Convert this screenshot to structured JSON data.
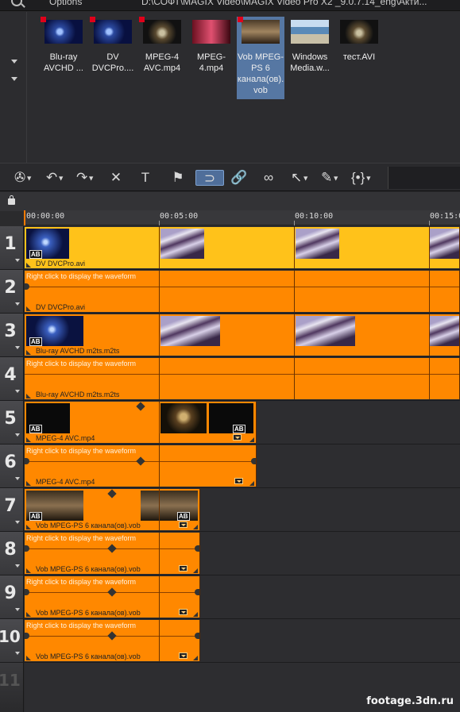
{
  "topbar": {
    "options_label": "Options",
    "path": "D:\\СОФТ\\MAGIX Video\\MAGIX Video Pro X2 _9.0.7.14_eng\\Акти..."
  },
  "media_pool": {
    "files": [
      {
        "label": "Blu-ray AVCHD ...",
        "thumb": "blue",
        "marked": true,
        "selected": false
      },
      {
        "label": "DV DVCPro....",
        "thumb": "blue",
        "marked": true,
        "selected": false
      },
      {
        "label": "MPEG-4 AVC.mp4",
        "thumb": "fan",
        "marked": true,
        "selected": false
      },
      {
        "label": "MPEG-4.mp4",
        "thumb": "pink",
        "marked": false,
        "selected": false
      },
      {
        "label": "Vob MPEG-PS 6 канала(ов).vob",
        "thumb": "movie",
        "marked": true,
        "selected": true
      },
      {
        "label": "Windows Media.w...",
        "thumb": "sea",
        "marked": false,
        "selected": false
      },
      {
        "label": "тест.AVI",
        "thumb": "fan",
        "marked": false,
        "selected": false
      }
    ]
  },
  "toolbar": {
    "buttons": [
      {
        "name": "reel-menu-button",
        "icon": "reel-icon",
        "glyph": "✇",
        "dropdown": true,
        "active": false
      },
      {
        "name": "undo-button",
        "icon": "undo-icon",
        "glyph": "↶",
        "dropdown": true,
        "active": false
      },
      {
        "name": "redo-button",
        "icon": "redo-icon",
        "glyph": "↷",
        "dropdown": true,
        "active": false
      },
      {
        "name": "delete-button",
        "icon": "close-icon",
        "glyph": "✕",
        "dropdown": false,
        "active": false
      },
      {
        "name": "title-button",
        "icon": "text-icon",
        "glyph": "T",
        "dropdown": false,
        "active": false
      },
      {
        "name": "marker-button",
        "icon": "flag-icon",
        "glyph": "⚑",
        "dropdown": false,
        "active": false
      },
      {
        "name": "magnet-button",
        "icon": "magnet-icon",
        "glyph": "⊃",
        "dropdown": false,
        "active": true
      },
      {
        "name": "link-button",
        "icon": "link-icon",
        "glyph": "🔗",
        "dropdown": false,
        "active": false
      },
      {
        "name": "unlink-button",
        "icon": "unlink-icon",
        "glyph": "∞",
        "dropdown": false,
        "active": false
      },
      {
        "name": "mouse-mode-button",
        "icon": "cursor-icon",
        "glyph": "↖",
        "dropdown": true,
        "active": false
      },
      {
        "name": "razor-button",
        "icon": "razor-icon",
        "glyph": "✎",
        "dropdown": true,
        "active": false
      },
      {
        "name": "group-button",
        "icon": "bracket-icon",
        "glyph": "{•}",
        "dropdown": true,
        "active": false
      }
    ]
  },
  "ruler": {
    "ticks": [
      "00:00:00",
      "00:05:00",
      "00:10:00",
      "00:15:00"
    ]
  },
  "tracks": {
    "numbers": [
      "1",
      "2",
      "3",
      "4",
      "5",
      "6",
      "7",
      "8",
      "9",
      "10",
      "11"
    ],
    "waveform_hint": "Right click to display the waveform",
    "ab_badge": "AB",
    "clip_names": {
      "dv": "DV DVCPro.avi",
      "bluray": "Blu-ray AVCHD m2ts.m2ts",
      "mpeg4": "MPEG-4 AVC.mp4",
      "vob": "Vob MPEG-PS 6 канала(ов).vob"
    }
  },
  "watermark": "footage.3dn.ru",
  "colors": {
    "clip_orange": "#ff8800",
    "clip_yellow": "#ffc21a",
    "selection_blue": "#5677a3",
    "marker_red": "#e0001a"
  }
}
